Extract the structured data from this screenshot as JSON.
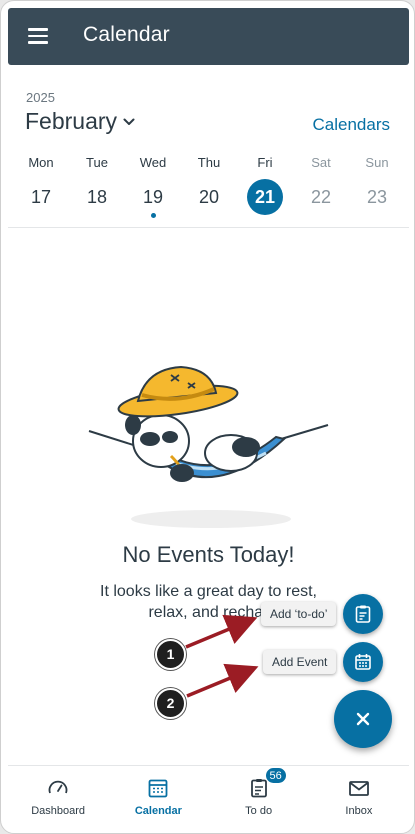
{
  "header": {
    "title": "Calendar"
  },
  "calendar": {
    "year": "2025",
    "month": "February",
    "calendars_link": "Calendars",
    "days": [
      {
        "name": "Mon",
        "num": "17"
      },
      {
        "name": "Tue",
        "num": "18"
      },
      {
        "name": "Wed",
        "num": "19"
      },
      {
        "name": "Thu",
        "num": "20"
      },
      {
        "name": "Fri",
        "num": "21"
      },
      {
        "name": "Sat",
        "num": "22"
      },
      {
        "name": "Sun",
        "num": "23"
      }
    ],
    "selected_day": "21",
    "day_with_event": "19"
  },
  "empty_state": {
    "title": "No Events Today!",
    "subtitle_line1": "It looks like a great day to rest,",
    "subtitle_line2": "relax, and rechar"
  },
  "fab_menu": {
    "add_todo_label": "Add ‘to-do’",
    "add_event_label": "Add Event"
  },
  "callouts": {
    "one": "1",
    "two": "2"
  },
  "bottom_nav": {
    "dashboard": "Dashboard",
    "calendar": "Calendar",
    "todo": "To do",
    "todo_badge": "56",
    "inbox": "Inbox"
  },
  "colors": {
    "header": "#394b58",
    "accent": "#0770a3",
    "arrow": "#9b1c24"
  }
}
